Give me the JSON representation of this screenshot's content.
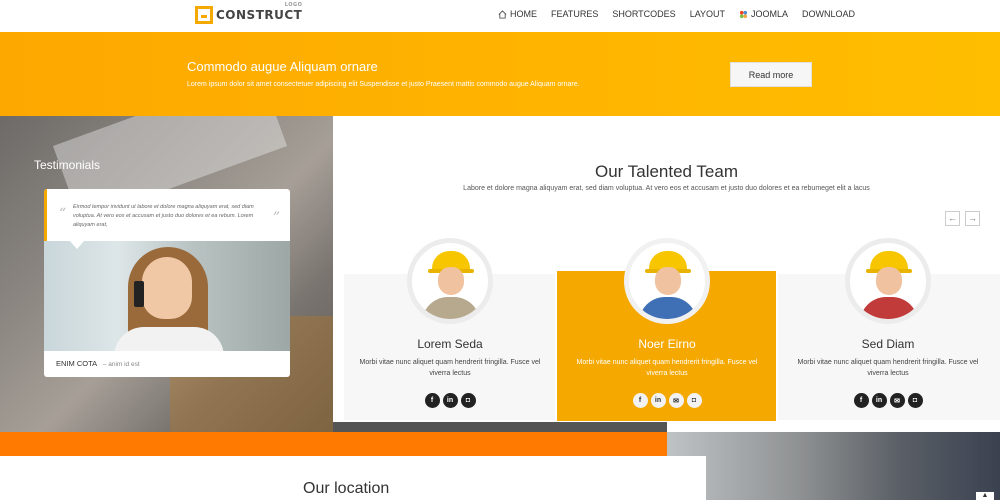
{
  "header": {
    "logo_text": "CONSTRUCT",
    "logo_sup": "LOGO",
    "nav": [
      "HOME",
      "FEATURES",
      "SHORTCODES",
      "LAYOUT",
      "JOOMLA",
      "DOWNLOAD"
    ]
  },
  "banner": {
    "title": "Commodo augue Aliquam ornare",
    "text": "Lorem ipsum dolor sit amet consectetuer adipiscing elit Suspendisse et justo Praesent mattis commodo augue Aliquam ornare.",
    "button": "Read more"
  },
  "testimonials": {
    "title": "Testimonials",
    "quote": "Eirmod tempor invidunt ut labore et dolore magna aliquyam erat, sed diam voluptua. At vero eos et accusam et justo duo dolores et ea rebum. Lorem aliquyam erat,",
    "author": "ENIM COTA",
    "role": "anim id est"
  },
  "team": {
    "title": "Our Talented Team",
    "description": "Labore et dolore magna aliquyam erat, sed diam voluptua. At vero eos et accusam et justo duo dolores et ea rebumeget elit a lacus",
    "prev": "←",
    "next": "→",
    "members": [
      {
        "name": "Lorem Seda",
        "text": "Morbi vitae nunc aliquet quam hendrerit fringilla. Fusce vel viverra lectus"
      },
      {
        "name": "Noer Eirno",
        "text": "Morbi vitae nunc aliquet quam hendrerit fringilla. Fusce vel viverra lectus"
      },
      {
        "name": "Sed Diam",
        "text": "Morbi vitae nunc aliquet quam hendrerit fringilla. Fusce vel viverra lectus"
      }
    ],
    "social_icons": [
      "facebook-icon",
      "linkedin-icon",
      "email-icon",
      "instagram-icon"
    ]
  },
  "location": {
    "title": "Our location"
  },
  "colors": {
    "accent": "#f5a800",
    "orange_bar": "#ff7a00"
  }
}
